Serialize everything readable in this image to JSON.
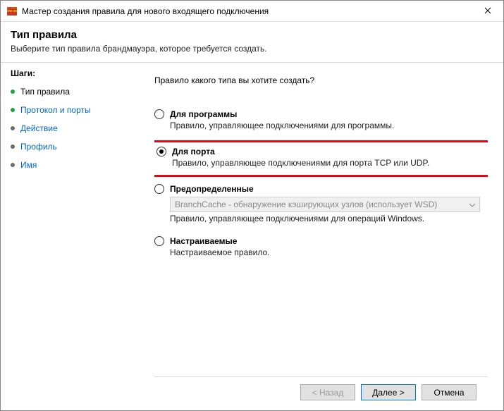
{
  "window": {
    "title": "Мастер создания правила для нового входящего подключения"
  },
  "header": {
    "title": "Тип правила",
    "subtitle": "Выберите тип правила брандмауэра, которое требуется создать."
  },
  "sidebar": {
    "title": "Шаги:",
    "items": [
      {
        "label": "Тип правила",
        "bullet_color": "#1aa33a",
        "link": false
      },
      {
        "label": "Протокол и порты",
        "bullet_color": "#1aa33a",
        "link": true
      },
      {
        "label": "Действие",
        "bullet_color": "#6a6a6a",
        "link": true
      },
      {
        "label": "Профиль",
        "bullet_color": "#6a6a6a",
        "link": true
      },
      {
        "label": "Имя",
        "bullet_color": "#6a6a6a",
        "link": true
      }
    ]
  },
  "content": {
    "question": "Правило какого типа вы хотите создать?",
    "options": [
      {
        "id": "program",
        "label": "Для программы",
        "desc": "Правило, управляющее подключениями для программы.",
        "selected": false,
        "highlight": false
      },
      {
        "id": "port",
        "label": "Для порта",
        "desc": "Правило, управляющее подключениями для порта TCP или UDP.",
        "selected": true,
        "highlight": true
      },
      {
        "id": "predefined",
        "label": "Предопределенные",
        "desc": "Правило, управляющее подключениями для операций Windows.",
        "dropdown": "BranchCache - обнаружение кэширующих узлов (использует WSD)",
        "selected": false,
        "highlight": false
      },
      {
        "id": "custom",
        "label": "Настраиваемые",
        "desc": "Настраиваемое правило.",
        "selected": false,
        "highlight": false
      }
    ]
  },
  "footer": {
    "back": "< Назад",
    "next": "Далее >",
    "cancel": "Отмена"
  }
}
